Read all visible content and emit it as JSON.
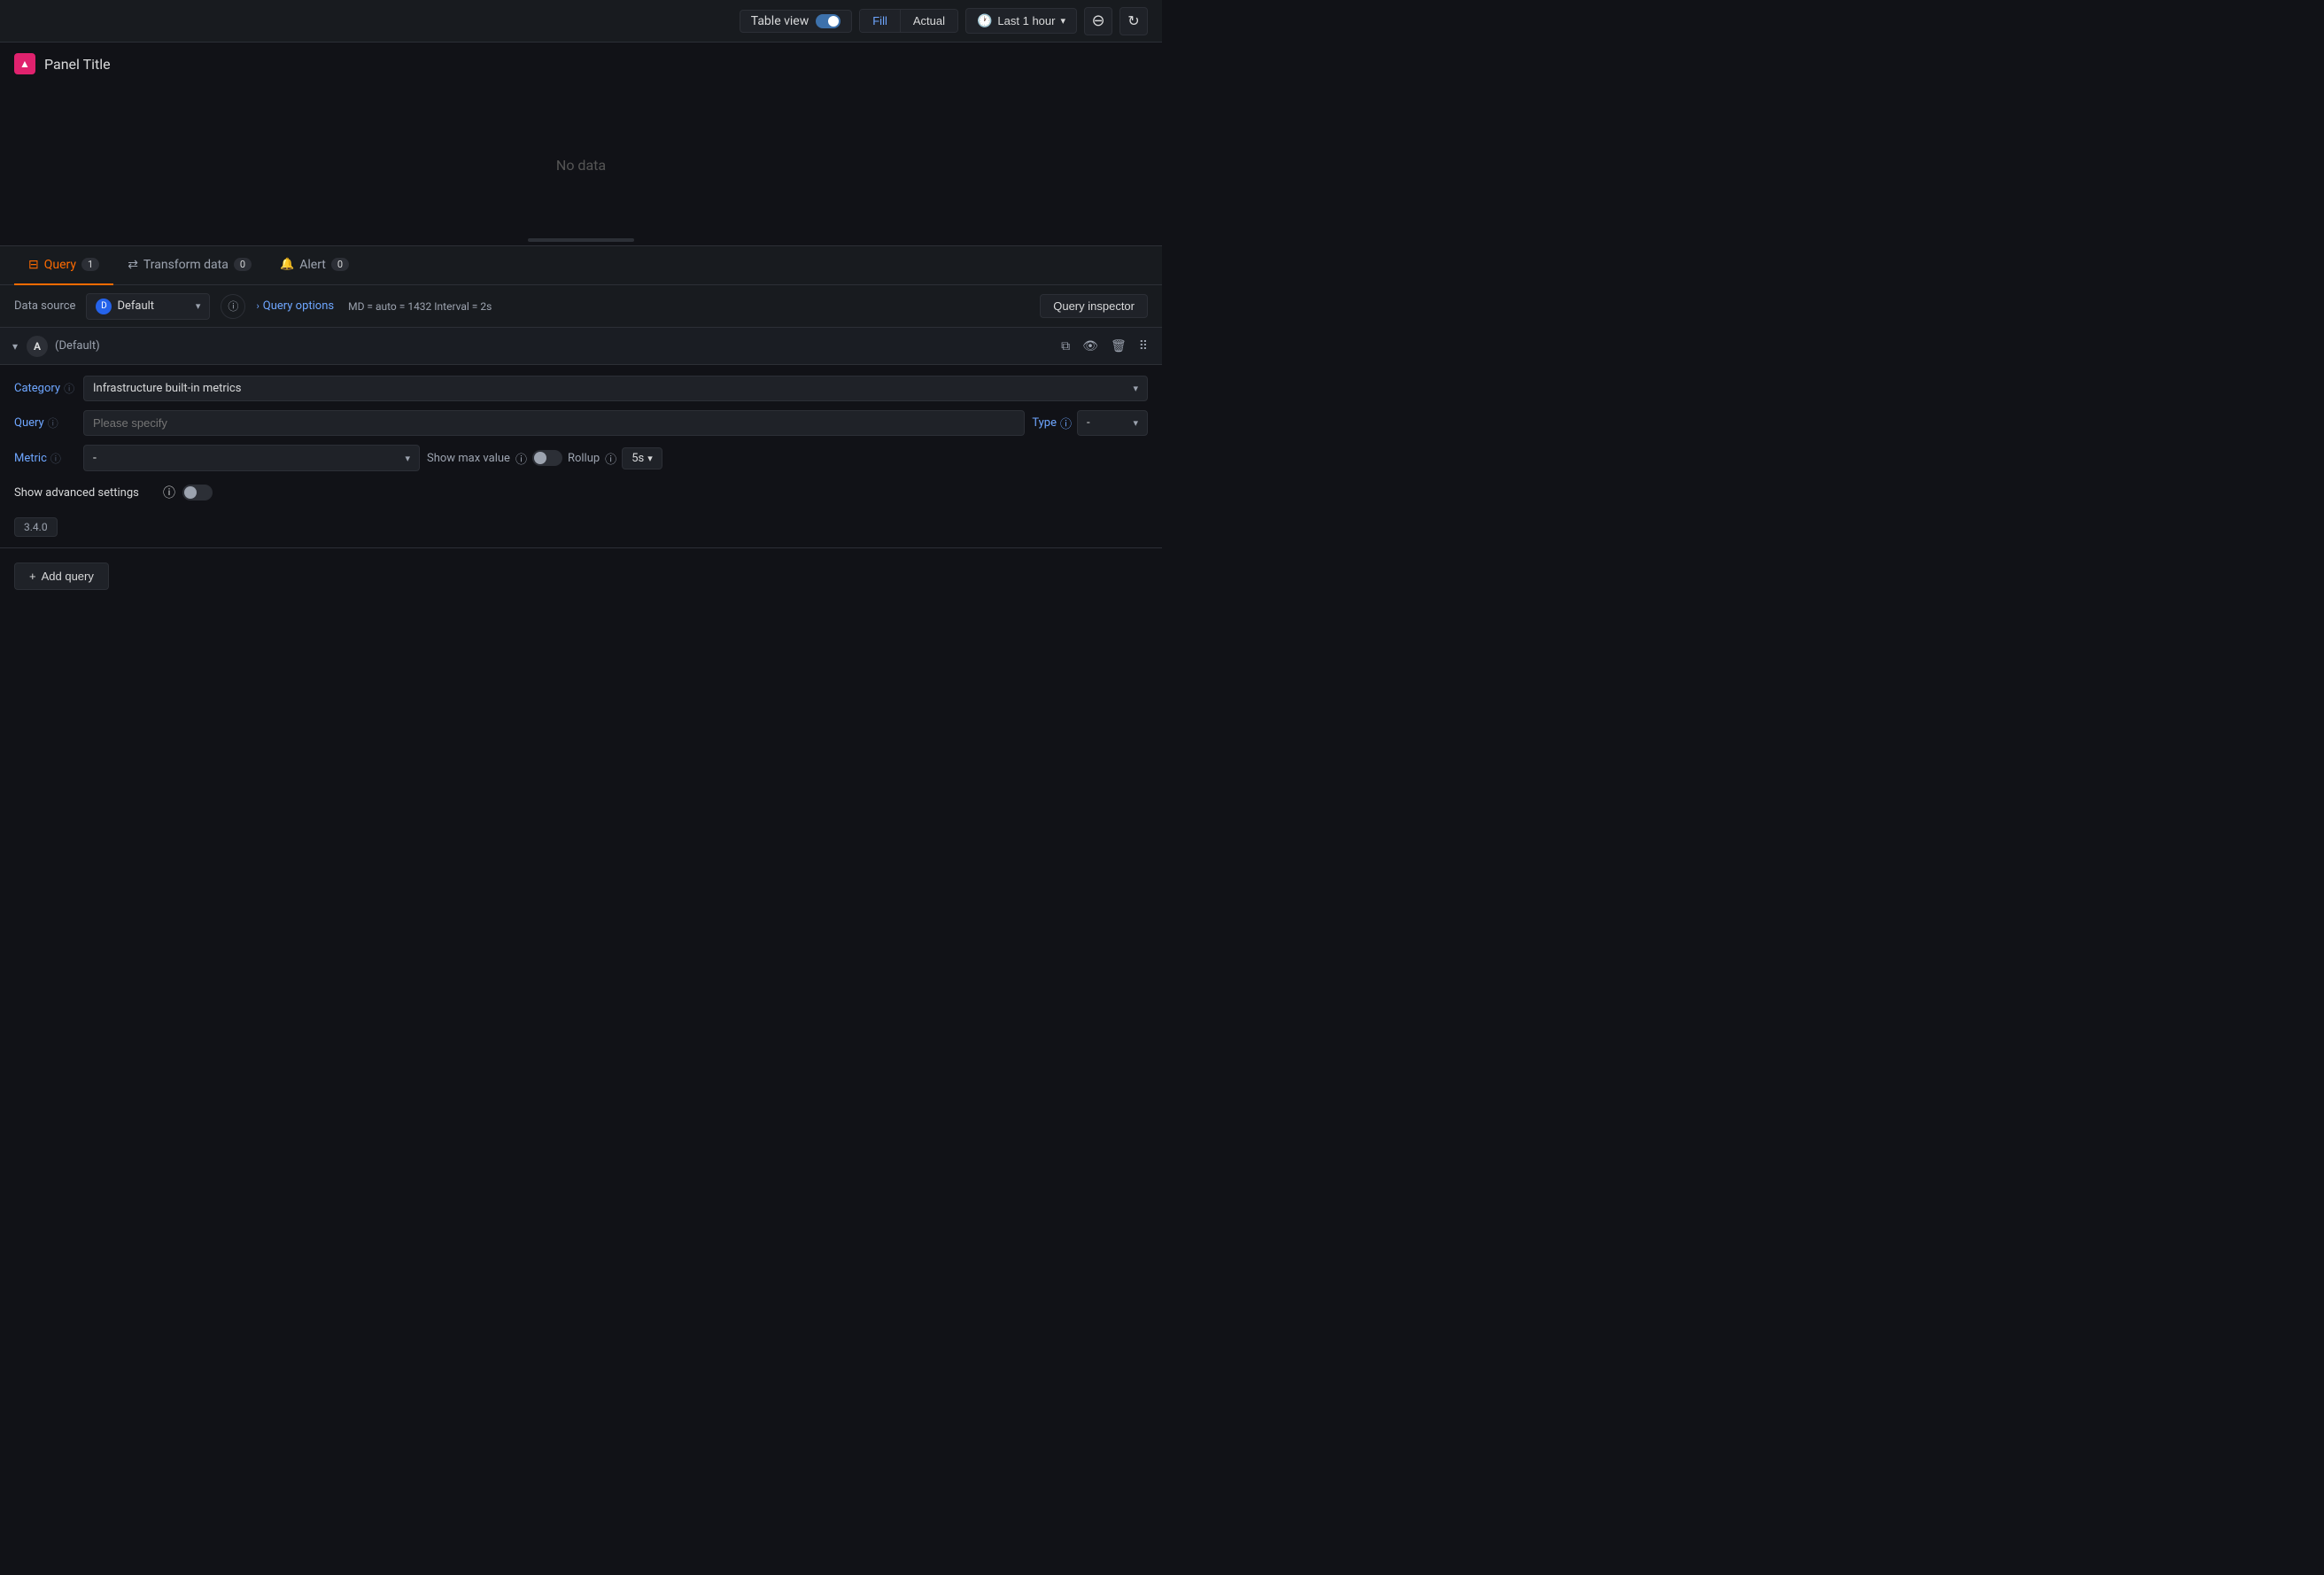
{
  "toolbar": {
    "table_view_label": "Table view",
    "fill_label": "Fill",
    "actual_label": "Actual",
    "time_range_label": "Last 1 hour",
    "zoom_icon": "−",
    "refresh_icon": "↻"
  },
  "panel": {
    "alert_icon": "▲",
    "title": "Panel Title",
    "no_data": "No data"
  },
  "tabs": [
    {
      "id": "query",
      "icon": "⊟",
      "label": "Query",
      "badge": "1",
      "active": true
    },
    {
      "id": "transform",
      "icon": "⇄",
      "label": "Transform data",
      "badge": "0",
      "active": false
    },
    {
      "id": "alert",
      "icon": "🔔",
      "label": "Alert",
      "badge": "0",
      "active": false
    }
  ],
  "datasource": {
    "label": "Data source",
    "name": "Default",
    "icon": "D"
  },
  "query_options": {
    "label": "Query options",
    "meta": "MD = auto = 1432   Interval = 2s"
  },
  "query_inspector": {
    "label": "Query inspector"
  },
  "query_row": {
    "letter": "A",
    "alias": "(Default)",
    "fields": {
      "category": {
        "label": "Category",
        "value": "Infrastructure built-in metrics"
      },
      "query": {
        "label": "Query",
        "placeholder": "Please specify",
        "type_label": "Type",
        "type_value": "-"
      },
      "metric": {
        "label": "Metric",
        "value": "-",
        "show_max_label": "Show max value",
        "rollup_label": "Rollup",
        "rollup_value": "5s"
      },
      "advanced": {
        "label": "Show advanced settings"
      }
    },
    "version": "3.4.0"
  },
  "add_query": {
    "label": "Add query",
    "icon": "+"
  }
}
